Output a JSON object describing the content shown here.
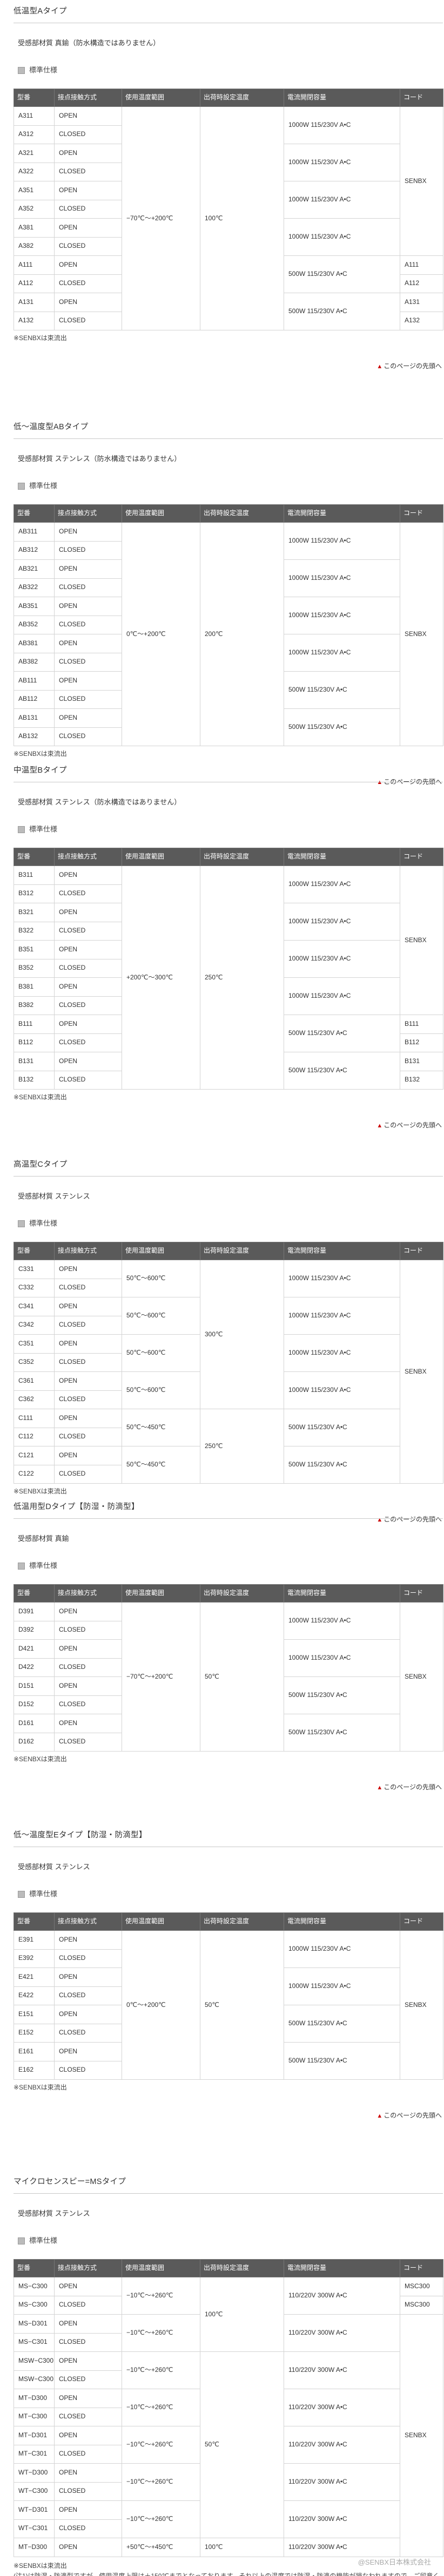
{
  "common": {
    "th": [
      "型番",
      "接点接触方式",
      "使用温度範囲",
      "出荷時設定温度",
      "電流開閉容量",
      "コード"
    ],
    "std_label": "標準仕様",
    "note": "※SENBXは束流出",
    "totop": "このページの先頭へ"
  },
  "sections": [
    {
      "title": "低温型Aタイプ",
      "material": "受感部材質 真鍮（防水構造ではありません）",
      "rows": [
        {
          "model": "A311",
          "contact": "OPEN"
        },
        {
          "model": "A312",
          "contact": "CLOSED"
        },
        {
          "model": "A321",
          "contact": "OPEN"
        },
        {
          "model": "A322",
          "contact": "CLOSED"
        },
        {
          "model": "A351",
          "contact": "OPEN"
        },
        {
          "model": "A352",
          "contact": "CLOSED"
        },
        {
          "model": "A381",
          "contact": "OPEN"
        },
        {
          "model": "A382",
          "contact": "CLOSED"
        },
        {
          "model": "A111",
          "contact": "OPEN"
        },
        {
          "model": "A112",
          "contact": "CLOSED"
        },
        {
          "model": "A131",
          "contact": "OPEN"
        },
        {
          "model": "A132",
          "contact": "CLOSED"
        }
      ],
      "range": "−70℃〜+200℃",
      "setting": "100℃",
      "capacity": [
        "1000W 115/230V A•C",
        "1000W 115/230V A•C",
        "1000W 115/230V A•C",
        "1000W 115/230V A•C",
        "500W 115/230V A•C",
        "500W 115/230V A•C"
      ],
      "code_main": "SENBX",
      "code_tail": [
        "A111",
        "A112",
        "A131",
        "A132"
      ]
    },
    {
      "title": "低〜温度型ABタイプ",
      "material": "受感部材質 ステンレス（防水構造ではありません）",
      "rows": [
        {
          "model": "AB311",
          "contact": "OPEN"
        },
        {
          "model": "AB312",
          "contact": "CLOSED"
        },
        {
          "model": "AB321",
          "contact": "OPEN"
        },
        {
          "model": "AB322",
          "contact": "CLOSED"
        },
        {
          "model": "AB351",
          "contact": "OPEN"
        },
        {
          "model": "AB352",
          "contact": "CLOSED"
        },
        {
          "model": "AB381",
          "contact": "OPEN"
        },
        {
          "model": "AB382",
          "contact": "CLOSED"
        },
        {
          "model": "AB111",
          "contact": "OPEN"
        },
        {
          "model": "AB112",
          "contact": "CLOSED"
        },
        {
          "model": "AB131",
          "contact": "OPEN"
        },
        {
          "model": "AB132",
          "contact": "CLOSED"
        }
      ],
      "range": "0℃〜+200℃",
      "setting": "200℃",
      "capacity": [
        "1000W 115/230V A•C",
        "1000W 115/230V A•C",
        "1000W 115/230V A•C",
        "1000W 115/230V A•C",
        "500W 115/230V A•C",
        "500W 115/230V A•C"
      ],
      "code_main": "SENBX"
    },
    {
      "title": "中温型Bタイプ",
      "material": "受感部材質 ステンレス（防水構造ではありません）",
      "rows": [
        {
          "model": "B311",
          "contact": "OPEN"
        },
        {
          "model": "B312",
          "contact": "CLOSED"
        },
        {
          "model": "B321",
          "contact": "OPEN"
        },
        {
          "model": "B322",
          "contact": "CLOSED"
        },
        {
          "model": "B351",
          "contact": "OPEN"
        },
        {
          "model": "B352",
          "contact": "CLOSED"
        },
        {
          "model": "B381",
          "contact": "OPEN"
        },
        {
          "model": "B382",
          "contact": "CLOSED"
        },
        {
          "model": "B111",
          "contact": "OPEN"
        },
        {
          "model": "B112",
          "contact": "CLOSED"
        },
        {
          "model": "B131",
          "contact": "OPEN"
        },
        {
          "model": "B132",
          "contact": "CLOSED"
        }
      ],
      "range": "+200℃〜300℃",
      "setting": "250℃",
      "capacity": [
        "1000W 115/230V A•C",
        "1000W 115/230V A•C",
        "1000W 115/230V A•C",
        "1000W 115/230V A•C",
        "500W 115/230V A•C",
        "500W 115/230V A•C"
      ],
      "code_main": "SENBX",
      "code_tail": [
        "B111",
        "B112",
        "B131",
        "B132"
      ]
    },
    {
      "title": "高温型Cタイプ",
      "material": "受感部材質 ステンレス",
      "rows": [
        {
          "model": "C331",
          "contact": "OPEN"
        },
        {
          "model": "C332",
          "contact": "CLOSED"
        },
        {
          "model": "C341",
          "contact": "OPEN"
        },
        {
          "model": "C342",
          "contact": "CLOSED"
        },
        {
          "model": "C351",
          "contact": "OPEN"
        },
        {
          "model": "C352",
          "contact": "CLOSED"
        },
        {
          "model": "C361",
          "contact": "OPEN"
        },
        {
          "model": "C362",
          "contact": "CLOSED"
        },
        {
          "model": "C111",
          "contact": "OPEN"
        },
        {
          "model": "C112",
          "contact": "CLOSED"
        },
        {
          "model": "C121",
          "contact": "OPEN"
        },
        {
          "model": "C122",
          "contact": "CLOSED"
        }
      ],
      "ranges": [
        "50℃〜600℃",
        "50℃〜600℃",
        "50℃〜600℃",
        "50℃〜600℃",
        "50℃〜450℃",
        "50℃〜450℃"
      ],
      "settings": [
        "300℃",
        "250℃"
      ],
      "capacity": [
        "1000W 115/230V A•C",
        "1000W 115/230V A•C",
        "1000W 115/230V A•C",
        "1000W 115/230V A•C",
        "500W 115/230V A•C",
        "500W 115/230V A•C"
      ],
      "code_main": "SENBX"
    },
    {
      "title": "低温用型Dタイプ【防湿・防滴型】",
      "material": "受感部材質 真鍮",
      "rows": [
        {
          "model": "D391",
          "contact": "OPEN"
        },
        {
          "model": "D392",
          "contact": "CLOSED"
        },
        {
          "model": "D421",
          "contact": "OPEN"
        },
        {
          "model": "D422",
          "contact": "CLOSED"
        },
        {
          "model": "D151",
          "contact": "OPEN"
        },
        {
          "model": "D152",
          "contact": "CLOSED"
        },
        {
          "model": "D161",
          "contact": "OPEN"
        },
        {
          "model": "D162",
          "contact": "CLOSED"
        }
      ],
      "range": "−70℃〜+200℃",
      "setting": "50℃",
      "capacity": [
        "1000W 115/230V A•C",
        "1000W 115/230V A•C",
        "500W 115/230V A•C",
        "500W 115/230V A•C"
      ],
      "code_main": "SENBX"
    },
    {
      "title": "低〜温度型Eタイプ【防湿・防滴型】",
      "material": "受感部材質 ステンレス",
      "rows": [
        {
          "model": "E391",
          "contact": "OPEN"
        },
        {
          "model": "E392",
          "contact": "CLOSED"
        },
        {
          "model": "E421",
          "contact": "OPEN"
        },
        {
          "model": "E422",
          "contact": "CLOSED"
        },
        {
          "model": "E151",
          "contact": "OPEN"
        },
        {
          "model": "E152",
          "contact": "CLOSED"
        },
        {
          "model": "E161",
          "contact": "OPEN"
        },
        {
          "model": "E162",
          "contact": "CLOSED"
        }
      ],
      "range": "0℃〜+200℃",
      "setting": "50℃",
      "capacity": [
        "1000W 115/230V A•C",
        "1000W 115/230V A•C",
        "500W 115/230V A•C",
        "500W 115/230V A•C"
      ],
      "code_main": "SENBX"
    },
    {
      "title": "マイクロセンスピー=MSタイプ",
      "material": "受感部材質 ステンレス",
      "rows": [
        {
          "model": "MS−C300",
          "contact": "OPEN"
        },
        {
          "model": "MS−C300",
          "contact": "CLOSED"
        },
        {
          "model": "MS−D301",
          "contact": "OPEN"
        },
        {
          "model": "MS−C301",
          "contact": "CLOSED"
        },
        {
          "model": "MSW−C300",
          "contact": "OPEN",
          "sup": "(注1)"
        },
        {
          "model": "MSW−C300",
          "contact": "CLOSED",
          "sup": "(注1)"
        },
        {
          "model": "MT−D300",
          "contact": "OPEN"
        },
        {
          "model": "MT−C300",
          "contact": "CLOSED"
        },
        {
          "model": "MT−D301",
          "contact": "OPEN"
        },
        {
          "model": "MT−C301",
          "contact": "CLOSED"
        },
        {
          "model": "WT−D300",
          "contact": "OPEN"
        },
        {
          "model": "WT−C300",
          "contact": "CLOSED"
        },
        {
          "model": "WT−D301",
          "contact": "OPEN"
        },
        {
          "model": "WT−C301",
          "contact": "CLOSED"
        },
        {
          "model": "MT−D300",
          "contact": "OPEN"
        }
      ],
      "ranges": [
        "−10℃〜+260℃",
        "−10℃〜+260℃",
        "−10℃〜+260℃",
        "−10℃〜+260℃",
        "−10℃〜+260℃",
        "−10℃〜+260℃",
        "−10℃〜+260℃",
        "+50℃〜+450℃"
      ],
      "settings": [
        "100℃",
        "50℃",
        "100℃"
      ],
      "capacity": [
        "110/220V 300W A•C",
        "110/220V 300W A•C",
        "110/220V 300W A•C",
        "110/220V 300W A•C",
        "110/220V 300W A•C",
        "110/220V 300W A•C",
        "110/220V 300W A•C",
        "110/220V 300W A•C"
      ],
      "code_top": [
        "MSC300",
        "MSC300"
      ],
      "code_main": "SENBX"
    }
  ],
  "footnote_lines": [
    "※SENBXは束流出",
    "(注1)は防湿・防滴型ですが、使用温度上限は＋150℃までとなっております。それ以上の温度では防湿・防滴の機能が損なわれますので、ご留意ください。"
  ],
  "watermark": "@SENBX日本株式会社"
}
